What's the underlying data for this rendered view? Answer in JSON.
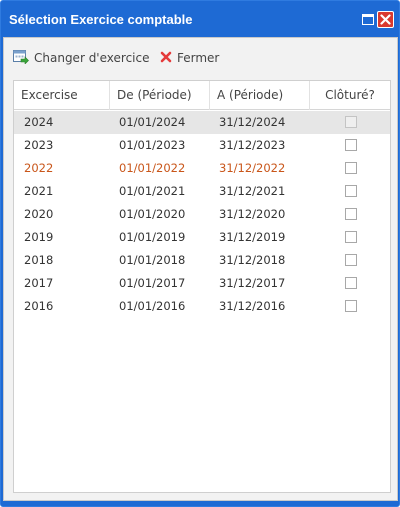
{
  "window": {
    "title": "Sélection Exercice comptable",
    "accent_color": "#1e6ad4",
    "close_color": "#d9392f"
  },
  "toolbar": {
    "change_label": "Changer d'exercice",
    "change_icon": "calendar-arrow-icon",
    "close_label": "Fermer",
    "close_icon": "red-x-icon"
  },
  "grid": {
    "columns": [
      "Excercise",
      "De (Période)",
      "A (Période)",
      "Clôturé?"
    ],
    "rows": [
      {
        "year": "2024",
        "from": "01/01/2024",
        "to": "31/12/2024",
        "closed": false,
        "selected": true,
        "current": false
      },
      {
        "year": "2023",
        "from": "01/01/2023",
        "to": "31/12/2023",
        "closed": false,
        "selected": false,
        "current": false
      },
      {
        "year": "2022",
        "from": "01/01/2022",
        "to": "31/12/2022",
        "closed": false,
        "selected": false,
        "current": true
      },
      {
        "year": "2021",
        "from": "01/01/2021",
        "to": "31/12/2021",
        "closed": false,
        "selected": false,
        "current": false
      },
      {
        "year": "2020",
        "from": "01/01/2020",
        "to": "31/12/2020",
        "closed": false,
        "selected": false,
        "current": false
      },
      {
        "year": "2019",
        "from": "01/01/2019",
        "to": "31/12/2019",
        "closed": false,
        "selected": false,
        "current": false
      },
      {
        "year": "2018",
        "from": "01/01/2018",
        "to": "31/12/2018",
        "closed": false,
        "selected": false,
        "current": false
      },
      {
        "year": "2017",
        "from": "01/01/2017",
        "to": "31/12/2017",
        "closed": false,
        "selected": false,
        "current": false
      },
      {
        "year": "2016",
        "from": "01/01/2016",
        "to": "31/12/2016",
        "closed": false,
        "selected": false,
        "current": false
      }
    ]
  }
}
